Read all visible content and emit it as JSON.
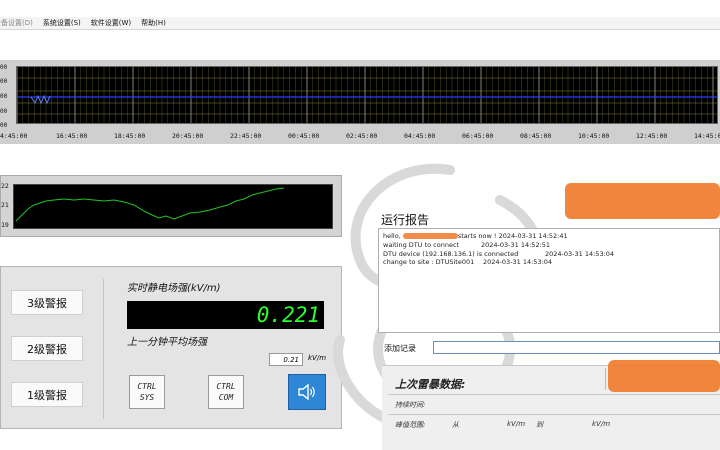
{
  "menu": [
    "设备设置(D)",
    "系统设置(S)",
    "软件设置(W)",
    "帮助(H)"
  ],
  "strip_chart": {
    "y_ticks": [
      "00",
      "00",
      "00",
      "00",
      "00"
    ],
    "x_ticks": [
      "4:45:00",
      "16:45:00",
      "18:45:00",
      "20:45:00",
      "22:45:00",
      "00:45:00",
      "02:45:00",
      "04:45:00",
      "06:45:00",
      "08:45:00",
      "10:45:00",
      "12:45:00",
      "14:45:00"
    ],
    "colors": {
      "background": "#000000",
      "grid": "#b9b84a",
      "baseline": "#2a3cff",
      "trace": "#2a3cff"
    }
  },
  "mini_chart": {
    "y_ticks": [
      "22",
      "21",
      "19"
    ],
    "colors": {
      "background": "#000000",
      "trace": "#22c322"
    }
  },
  "panel": {
    "alarm_buttons": [
      "3级警报",
      "2级警报",
      "1级警报"
    ],
    "realtime_label": "实时静电场强(kV/m)",
    "realtime_value": "0.221",
    "avg_label": "上一分钟平均场强",
    "avg_value": "0.21",
    "avg_unit": "kV/m",
    "ctrl_sys": [
      "CTRL",
      "SYS"
    ],
    "ctrl_com": [
      "CTRL",
      "COM"
    ],
    "speaker_icon": "speaker-icon"
  },
  "log": {
    "title": "运行报告",
    "lines": [
      {
        "text": "hello, ",
        "tail": "starts now !",
        "time": "2024-03-31 14:52:41"
      },
      {
        "text": "waiting DTU to connect",
        "time": "2024-03-31 14:52:51"
      },
      {
        "text": "DTU device (192.168.136.1) is connected",
        "time": "2024-03-31 14:53:04"
      },
      {
        "text": "change to site : DTUSite001",
        "time": "2024-03-31 14:53:04"
      }
    ],
    "add_label": "添加记录",
    "add_value": ""
  },
  "last_storm": {
    "title": "上次雷暴数据:",
    "duration_label": "持续时间:",
    "range_label": "峰值范围:",
    "from": "从",
    "unit1": "kV/m",
    "to": "到",
    "unit2": "kV/m"
  }
}
